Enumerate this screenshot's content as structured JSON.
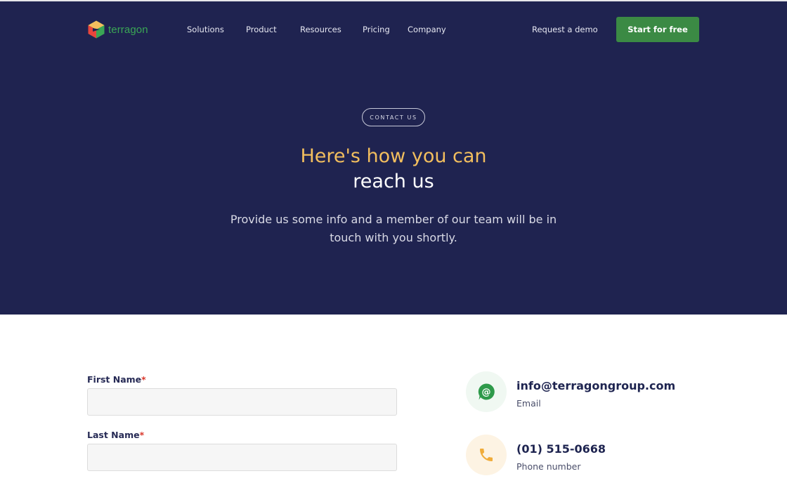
{
  "brand": {
    "name": "terragon"
  },
  "nav": {
    "items": [
      "Solutions",
      "Product",
      "Resources",
      "Pricing",
      "Company"
    ],
    "request_demo": "Request a demo",
    "start_free": "Start for free"
  },
  "hero": {
    "eyebrow": "CONTACT US",
    "title_line1": "Here's how you can",
    "title_line2": "reach us",
    "subtitle": "Provide us some info and a member of our team will be in touch with you shortly."
  },
  "form": {
    "first_name_label": "First Name",
    "last_name_label": "Last Name",
    "required_mark": "*",
    "first_name_value": "",
    "last_name_value": ""
  },
  "contact": {
    "email": {
      "value": "info@terragongroup.com",
      "label": "Email",
      "icon": "at-sign-icon"
    },
    "phone": {
      "value": "(01) 515-0668",
      "label": "Phone number",
      "icon": "phone-icon"
    }
  },
  "colors": {
    "hero_bg": "#1f2350",
    "accent_yellow": "#f2be5e",
    "cta_green": "#3b8a44",
    "brand_green": "#3aa655",
    "required_red": "#d9372b"
  }
}
